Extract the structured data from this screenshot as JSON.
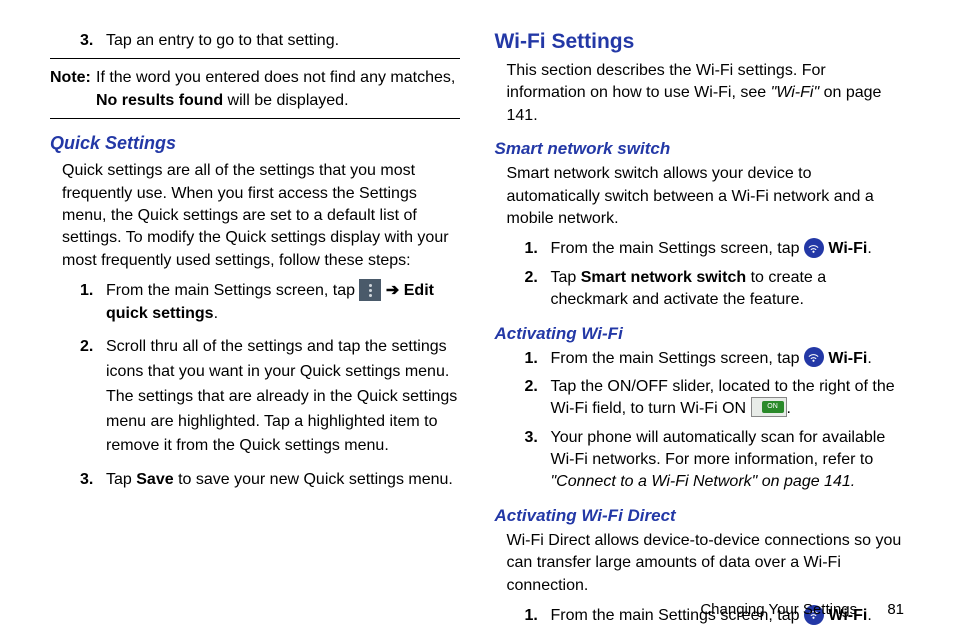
{
  "left": {
    "step3_num": "3.",
    "step3_text": "Tap an entry to go to that setting.",
    "note_label": "Note:",
    "note_pre": "If the word you entered does not find any matches, ",
    "note_bold": "No results found",
    "note_post": " will be displayed.",
    "qs_heading": "Quick Settings",
    "qs_body": "Quick settings are all of the settings that you most frequently use. When you first access the Settings menu, the Quick settings are set to a default list of settings. To modify the Quick settings display with your most frequently used settings, follow these steps:",
    "qs1_num": "1.",
    "qs1_pre": "From the main Settings screen, tap ",
    "qs1_arrow": " ➔ ",
    "qs1_bold": "Edit quick settings",
    "qs1_post": ".",
    "qs2_num": "2.",
    "qs2_text": "Scroll thru all of the settings and tap the settings icons that you want in your Quick settings menu. The settings that are already in the Quick settings menu are highlighted. Tap a highlighted item to remove it from the Quick settings menu.",
    "qs3_num": "3.",
    "qs3_pre": "Tap ",
    "qs3_bold": "Save",
    "qs3_post": " to save your new Quick settings menu."
  },
  "right": {
    "wifi_heading": "Wi-Fi Settings",
    "wifi_body_pre": "This section describes the Wi-Fi settings. For information on how to use Wi-Fi, see ",
    "wifi_body_italic": "\"Wi-Fi\"",
    "wifi_body_post": " on page 141.",
    "sns_heading": "Smart network switch",
    "sns_body": "Smart network switch allows your device to automatically switch between a Wi-Fi network and a mobile network.",
    "sns1_num": "1.",
    "sns1_pre": "From the main Settings screen, tap ",
    "sns1_bold": " Wi-Fi",
    "sns1_post": ".",
    "sns2_num": "2.",
    "sns2_pre": "Tap ",
    "sns2_bold": "Smart network switch",
    "sns2_post": " to create a checkmark and activate the feature.",
    "act_heading": "Activating Wi-Fi",
    "act1_num": "1.",
    "act1_pre": "From the main Settings screen, tap ",
    "act1_bold": " Wi-Fi",
    "act1_post": ".",
    "act2_num": "2.",
    "act2_pre": "Tap the ON/OFF slider, located to the right of the Wi-Fi field, to turn Wi-Fi ON ",
    "act2_on": "ON",
    "act2_post": ".",
    "act3_num": "3.",
    "act3_pre": "Your phone will automatically scan for available Wi-Fi networks. For more information, refer to ",
    "act3_italic": "\"Connect to a Wi-Fi Network\"  on page 141.",
    "wfd_heading": "Activating Wi-Fi Direct",
    "wfd_body": "Wi-Fi Direct allows device-to-device connections so you can transfer large amounts of data over a Wi-Fi connection.",
    "wfd1_num": "1.",
    "wfd1_pre": "From the main Settings screen, tap ",
    "wfd1_bold": " Wi-Fi",
    "wfd1_post": "."
  },
  "footer": {
    "section": "Changing Your Settings",
    "page": "81"
  }
}
